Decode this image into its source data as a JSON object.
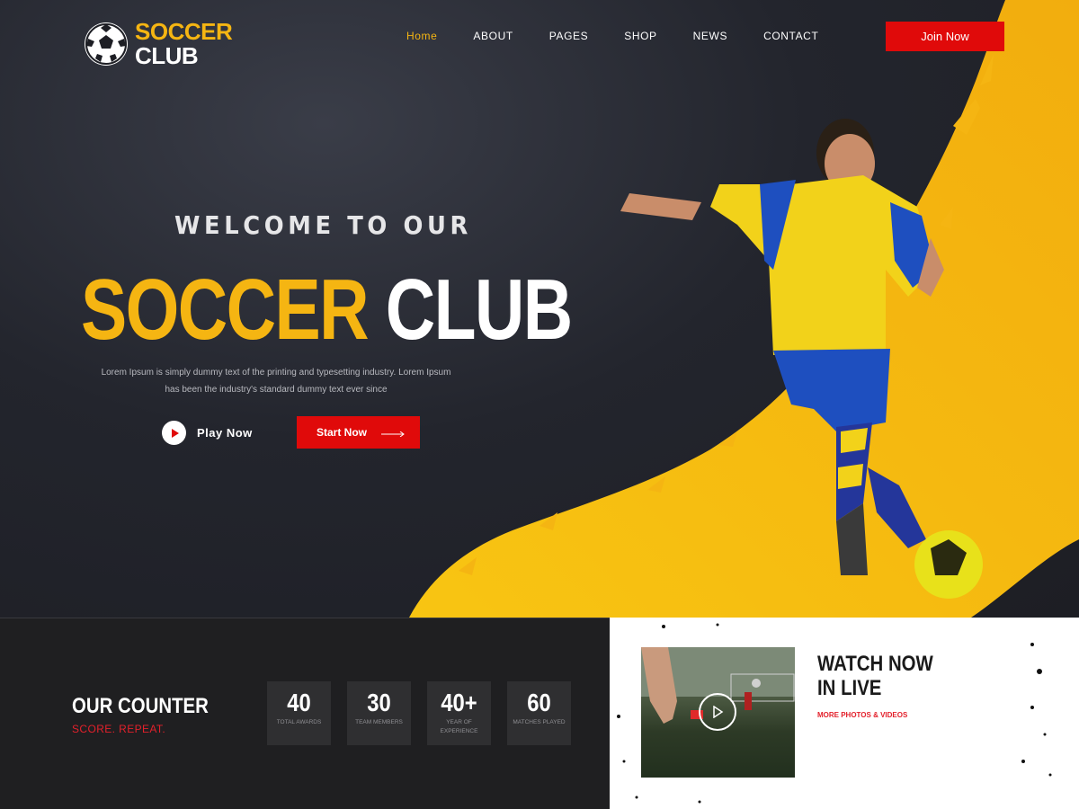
{
  "brand": {
    "line1": "SOCCER",
    "line2": "CLUB",
    "logo_icon": "soccer-ball-icon"
  },
  "nav": {
    "items": [
      {
        "label": "Home",
        "active": true
      },
      {
        "label": "ABOUT",
        "active": false
      },
      {
        "label": "PAGES",
        "active": false
      },
      {
        "label": "SHOP",
        "active": false
      },
      {
        "label": "NEWS",
        "active": false
      },
      {
        "label": "CONTACT",
        "active": false
      }
    ],
    "join_label": "Join Now"
  },
  "hero": {
    "welcome": "WELCOME TO OUR",
    "headline_yellow": "SOCCER",
    "headline_white": "CLUB",
    "description_line1": "Lorem Ipsum is simply dummy text of the printing and typesetting industry. Lorem Ipsum",
    "description_line2": "has been the industry's standard dummy text ever since",
    "play_label": "Play Now",
    "start_label": "Start Now"
  },
  "counter": {
    "title": "OUR COUNTER",
    "subtitle": "SCORE. REPEAT.",
    "stats": [
      {
        "value": "40",
        "label": "TOTAL AWARDS"
      },
      {
        "value": "30",
        "label": "TEAM MEMBERS"
      },
      {
        "value": "40+",
        "label": "YEAR OF EXPERIENCE"
      },
      {
        "value": "60",
        "label": "MATCHES PLAYED"
      }
    ]
  },
  "watch": {
    "title": "WATCH NOW IN LIVE",
    "link": "MORE PHOTOS & VIDEOS"
  },
  "colors": {
    "accent_yellow": "#f5b512",
    "accent_red": "#e00a0a",
    "dark_bg": "#1f1f21"
  }
}
